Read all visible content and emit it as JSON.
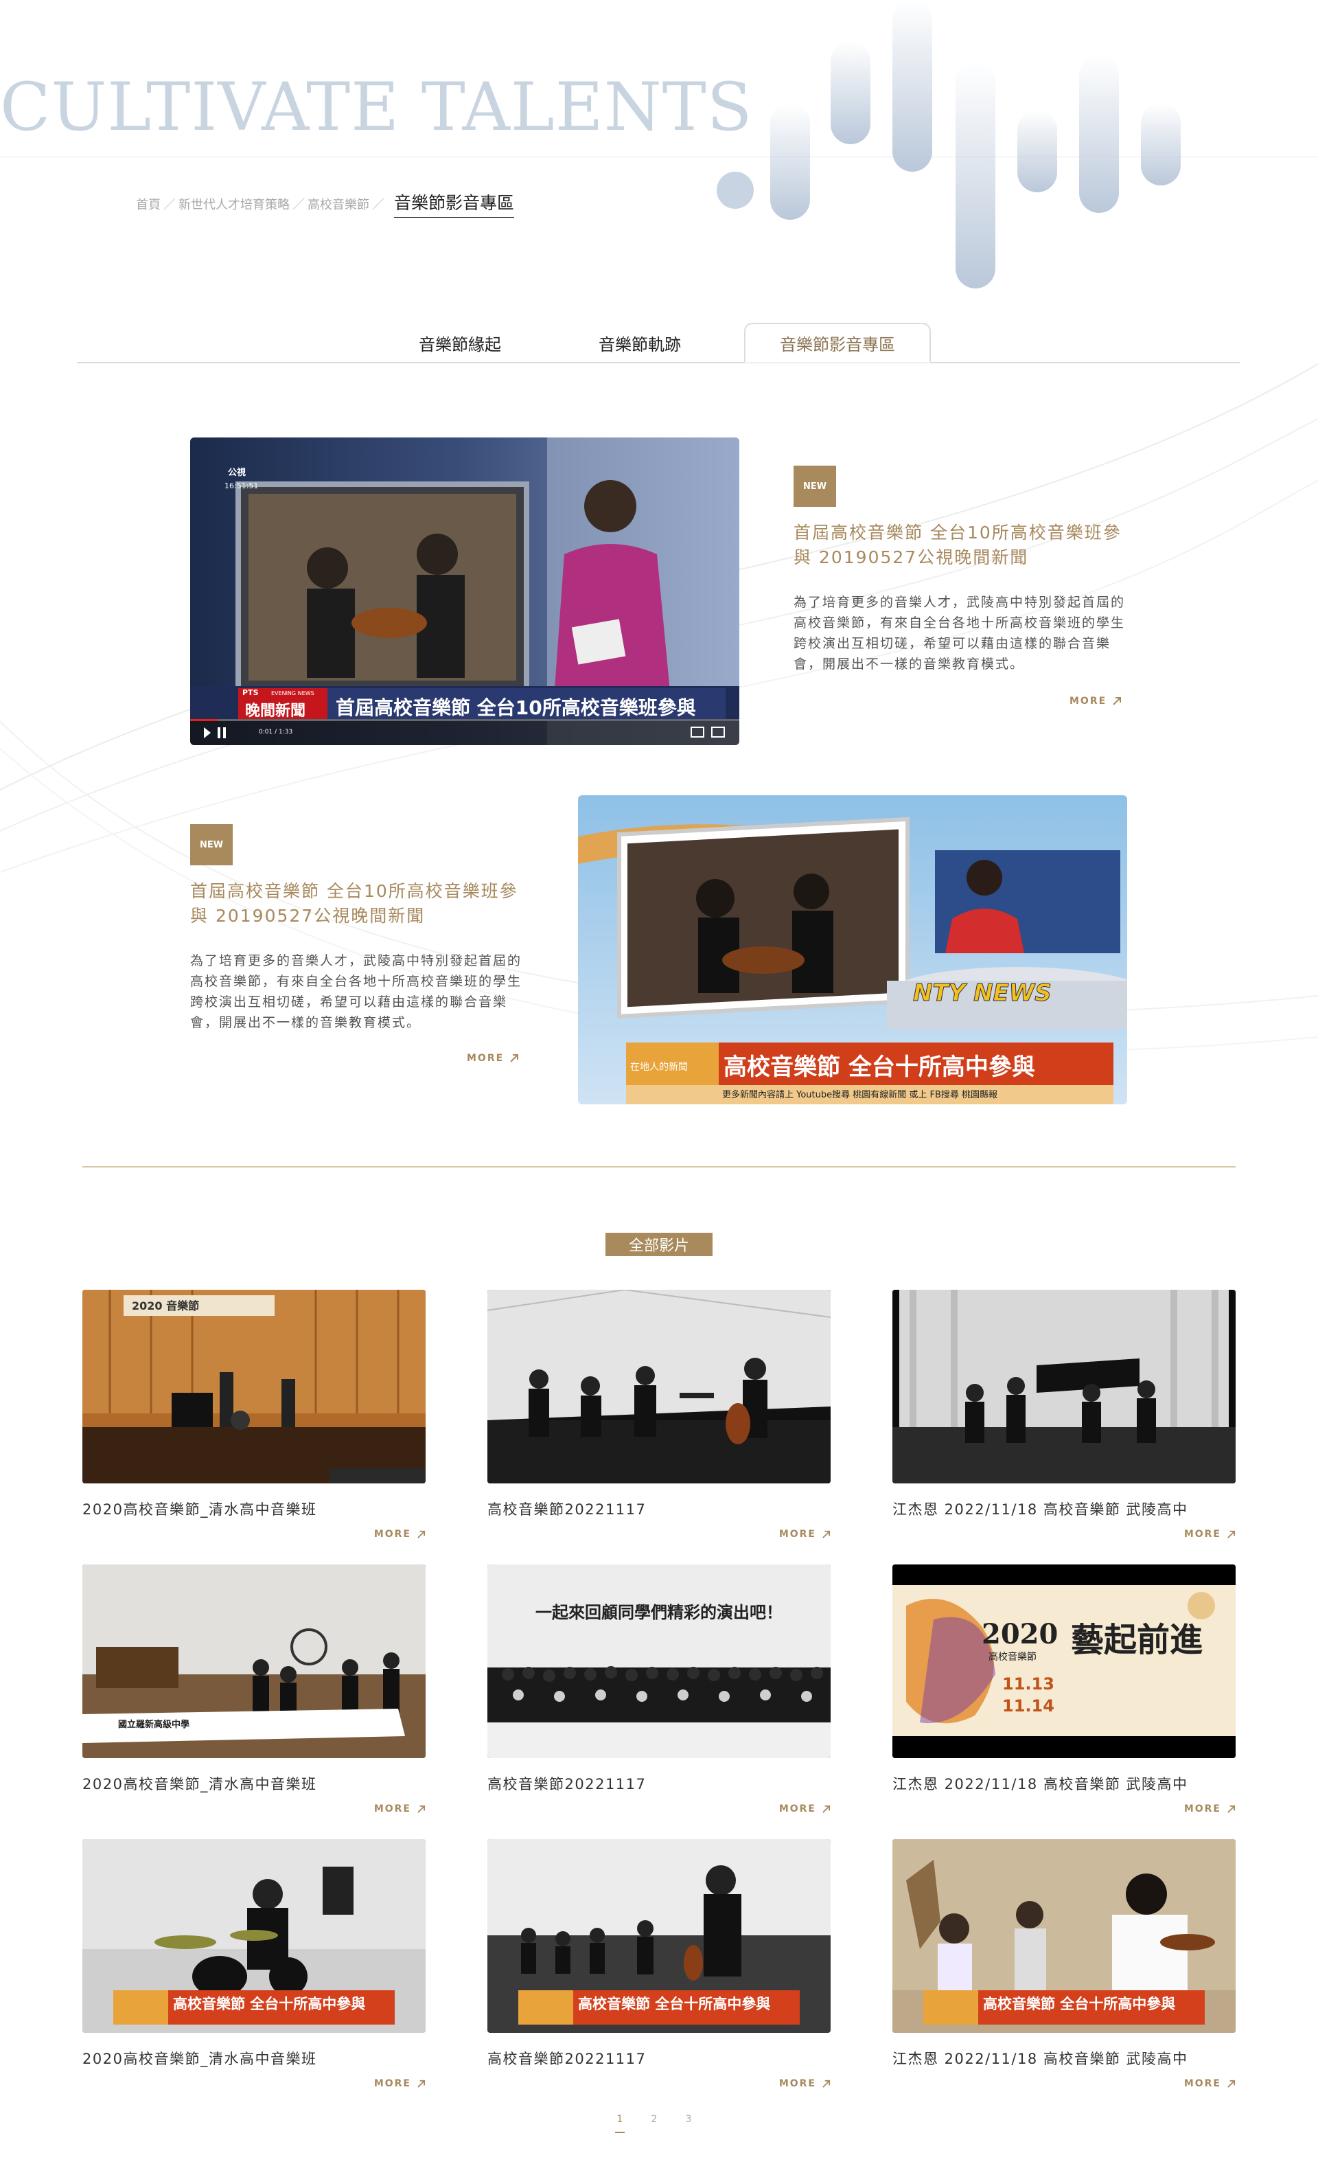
{
  "hero": {
    "title": "CULTIVATE TALENTS"
  },
  "breadcrumb": {
    "items": [
      "首頁",
      "新世代人才培育策略",
      "高校音樂節"
    ],
    "separator": "／",
    "current": "音樂節影音專區"
  },
  "tabs": [
    {
      "label": "音樂節緣起",
      "active": false
    },
    {
      "label": "音樂節軌跡",
      "active": false
    },
    {
      "label": "音樂節影音專區",
      "active": true
    }
  ],
  "features": [
    {
      "badge": "NEW",
      "title": "首屆高校音樂節 全台10所高校音樂班參與 20190527公視晚間新聞",
      "desc": "為了培育更多的音樂人才，武陵高中特別發起首屆的高校音樂節，有來自全台各地十所高校音樂班的學生跨校演出互相切磋，希望可以藉由這樣的聯合音樂會，開展出不一樣的音樂教育模式。",
      "more": "MORE",
      "thumb": {
        "logo": "公視",
        "time": "16:51:51",
        "show_brand": "PTS",
        "show_sub": "EVENING NEWS",
        "show_name": "晚間新聞",
        "caption": "首屆高校音樂節 全台10所高校音樂班參與",
        "player_time": "0:01 / 1:33"
      }
    },
    {
      "badge": "NEW",
      "title": "首屆高校音樂節 全台10所高校音樂班參與 20190527公視晚間新聞",
      "desc": "為了培育更多的音樂人才，武陵高中特別發起首屆的高校音樂節，有來自全台各地十所高校音樂班的學生跨校演出互相切磋，希望可以藉由這樣的聯合音樂會，開展出不一樣的音樂教育模式。",
      "more": "MORE",
      "thumb": {
        "desk": "NTY NEWS",
        "tag": "在地人的新聞",
        "caption": "高校音樂節 全台十所高中參與",
        "ticker": "更多新聞內容請上 Youtube搜尋 桃園有線新聞 或上 FB搜尋 桃園縣報"
      }
    }
  ],
  "all_label": "全部影片",
  "videos": [
    {
      "title": "2020高校音樂節_清水高中音樂班",
      "more": "MORE",
      "banner": "2020 音樂節"
    },
    {
      "title": "高校音樂節20221117",
      "more": "MORE"
    },
    {
      "title": "江杰恩 2022/11/18 高校音樂節 武陵高中",
      "more": "MORE"
    },
    {
      "title": "2020高校音樂節_清水高中音樂班",
      "more": "MORE",
      "school": "國立羅新高級中學"
    },
    {
      "title": "高校音樂節20221117",
      "more": "MORE",
      "overlay": "一起來回顧同學們精彩的演出吧！"
    },
    {
      "title": "江杰恩 2022/11/18 高校音樂節 武陵高中",
      "more": "MORE",
      "poster_year": "2020",
      "poster_name": "藝起前進",
      "poster_sub": "高校音樂節",
      "poster_d1": "11.13",
      "poster_d2": "11.14"
    },
    {
      "title": "2020高校音樂節_清水高中音樂班",
      "more": "MORE",
      "news": "高校音樂節 全台十所高中參與"
    },
    {
      "title": "高校音樂節20221117",
      "more": "MORE",
      "news": "高校音樂節 全台十所高中參與"
    },
    {
      "title": "江杰恩 2022/11/18 高校音樂節 武陵高中",
      "more": "MORE",
      "news": "高校音樂節 全台十所高中參與"
    }
  ],
  "pagination": [
    "1",
    "2",
    "3"
  ],
  "colors": {
    "accent": "#a88a5d",
    "hero": "#c9d4e1"
  }
}
